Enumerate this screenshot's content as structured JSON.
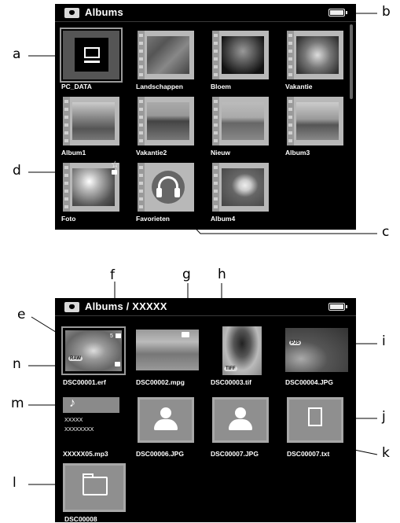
{
  "top_screen": {
    "title": "Albums",
    "albums": [
      {
        "label": "PC_DATA"
      },
      {
        "label": "Landschappen"
      },
      {
        "label": "Bloem"
      },
      {
        "label": "Vakantie"
      },
      {
        "label": "Album1"
      },
      {
        "label": "Vakantie2"
      },
      {
        "label": "Nieuw"
      },
      {
        "label": "Album3"
      },
      {
        "label": "Foto"
      },
      {
        "label": "Favorieten"
      },
      {
        "label": "Album4"
      }
    ]
  },
  "bottom_screen": {
    "title": "Albums / XXXXX",
    "files": [
      {
        "label": "DSC00001.erf",
        "badge": "RAW",
        "extra": "5"
      },
      {
        "label": "DSC00002.mpg"
      },
      {
        "label": "DSC00003.tif",
        "badge": "TIFF"
      },
      {
        "label": "DSC00004.JPG",
        "badge": "PJS"
      },
      {
        "label": "XXXXX05.mp3",
        "lines": [
          "XXXXX",
          "XXXXXXXX"
        ]
      },
      {
        "label": "DSC00006.JPG"
      },
      {
        "label": "DSC00007.JPG"
      },
      {
        "label": "DSC00007.txt"
      },
      {
        "label": "DSC00008"
      }
    ]
  },
  "callouts": {
    "a": "a",
    "b": "b",
    "c": "c",
    "d": "d",
    "e": "e",
    "f": "f",
    "g": "g",
    "h": "h",
    "i": "i",
    "j": "j",
    "k": "k",
    "l": "l",
    "m": "m",
    "n": "n"
  }
}
